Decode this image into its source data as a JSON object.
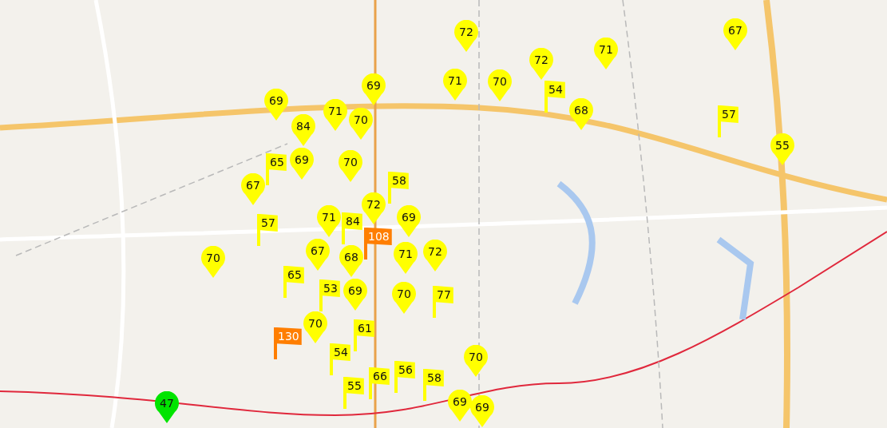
{
  "markers": [
    {
      "kind": "pin",
      "value": "72",
      "color": "#ffff00"
    },
    {
      "kind": "pin",
      "value": "67",
      "color": "#ffff00"
    },
    {
      "kind": "pin",
      "value": "71",
      "color": "#ffff00"
    },
    {
      "kind": "pin",
      "value": "72",
      "color": "#ffff00"
    },
    {
      "kind": "pin",
      "value": "69",
      "color": "#ffff00"
    },
    {
      "kind": "pin",
      "value": "71",
      "color": "#ffff00"
    },
    {
      "kind": "pin",
      "value": "70",
      "color": "#ffff00"
    },
    {
      "kind": "flag",
      "value": "54",
      "color": "#ffff00"
    },
    {
      "kind": "pin",
      "value": "69",
      "color": "#ffff00"
    },
    {
      "kind": "pin",
      "value": "71",
      "color": "#ffff00"
    },
    {
      "kind": "pin",
      "value": "70",
      "color": "#ffff00"
    },
    {
      "kind": "pin",
      "value": "68",
      "color": "#ffff00"
    },
    {
      "kind": "flag",
      "value": "57",
      "color": "#ffff00"
    },
    {
      "kind": "pin",
      "value": "84",
      "color": "#ffff00"
    },
    {
      "kind": "pin",
      "value": "55",
      "color": "#ffff00"
    },
    {
      "kind": "flag",
      "value": "65",
      "color": "#ffff00"
    },
    {
      "kind": "pin",
      "value": "69",
      "color": "#ffff00"
    },
    {
      "kind": "pin",
      "value": "70",
      "color": "#ffff00"
    },
    {
      "kind": "flag",
      "value": "58",
      "color": "#ffff00"
    },
    {
      "kind": "pin",
      "value": "67",
      "color": "#ffff00"
    },
    {
      "kind": "pin",
      "value": "72",
      "color": "#ffff00"
    },
    {
      "kind": "flag",
      "value": "57",
      "color": "#ffff00"
    },
    {
      "kind": "pin",
      "value": "71",
      "color": "#ffff00"
    },
    {
      "kind": "flag",
      "value": "84",
      "color": "#ffff00"
    },
    {
      "kind": "pin",
      "value": "69",
      "color": "#ffff00"
    },
    {
      "kind": "flag",
      "value": "108",
      "color": "#ff7e00"
    },
    {
      "kind": "pin",
      "value": "70",
      "color": "#ffff00"
    },
    {
      "kind": "pin",
      "value": "67",
      "color": "#ffff00"
    },
    {
      "kind": "pin",
      "value": "68",
      "color": "#ffff00"
    },
    {
      "kind": "pin",
      "value": "71",
      "color": "#ffff00"
    },
    {
      "kind": "pin",
      "value": "72",
      "color": "#ffff00"
    },
    {
      "kind": "flag",
      "value": "65",
      "color": "#ffff00"
    },
    {
      "kind": "flag",
      "value": "53",
      "color": "#ffff00"
    },
    {
      "kind": "pin",
      "value": "69",
      "color": "#ffff00"
    },
    {
      "kind": "pin",
      "value": "70",
      "color": "#ffff00"
    },
    {
      "kind": "flag",
      "value": "77",
      "color": "#ffff00"
    },
    {
      "kind": "flag",
      "value": "130",
      "color": "#ff7e00"
    },
    {
      "kind": "pin",
      "value": "70",
      "color": "#ffff00"
    },
    {
      "kind": "flag",
      "value": "61",
      "color": "#ffff00"
    },
    {
      "kind": "flag",
      "value": "54",
      "color": "#ffff00"
    },
    {
      "kind": "pin",
      "value": "70",
      "color": "#ffff00"
    },
    {
      "kind": "flag",
      "value": "55",
      "color": "#ffff00"
    },
    {
      "kind": "flag",
      "value": "66",
      "color": "#ffff00"
    },
    {
      "kind": "flag",
      "value": "56",
      "color": "#ffff00"
    },
    {
      "kind": "flag",
      "value": "58",
      "color": "#ffff00"
    },
    {
      "kind": "pin",
      "value": "47",
      "color": "#00e400"
    },
    {
      "kind": "pin",
      "value": "69",
      "color": "#ffff00"
    },
    {
      "kind": "pin",
      "value": "69",
      "color": "#ffff00"
    }
  ]
}
